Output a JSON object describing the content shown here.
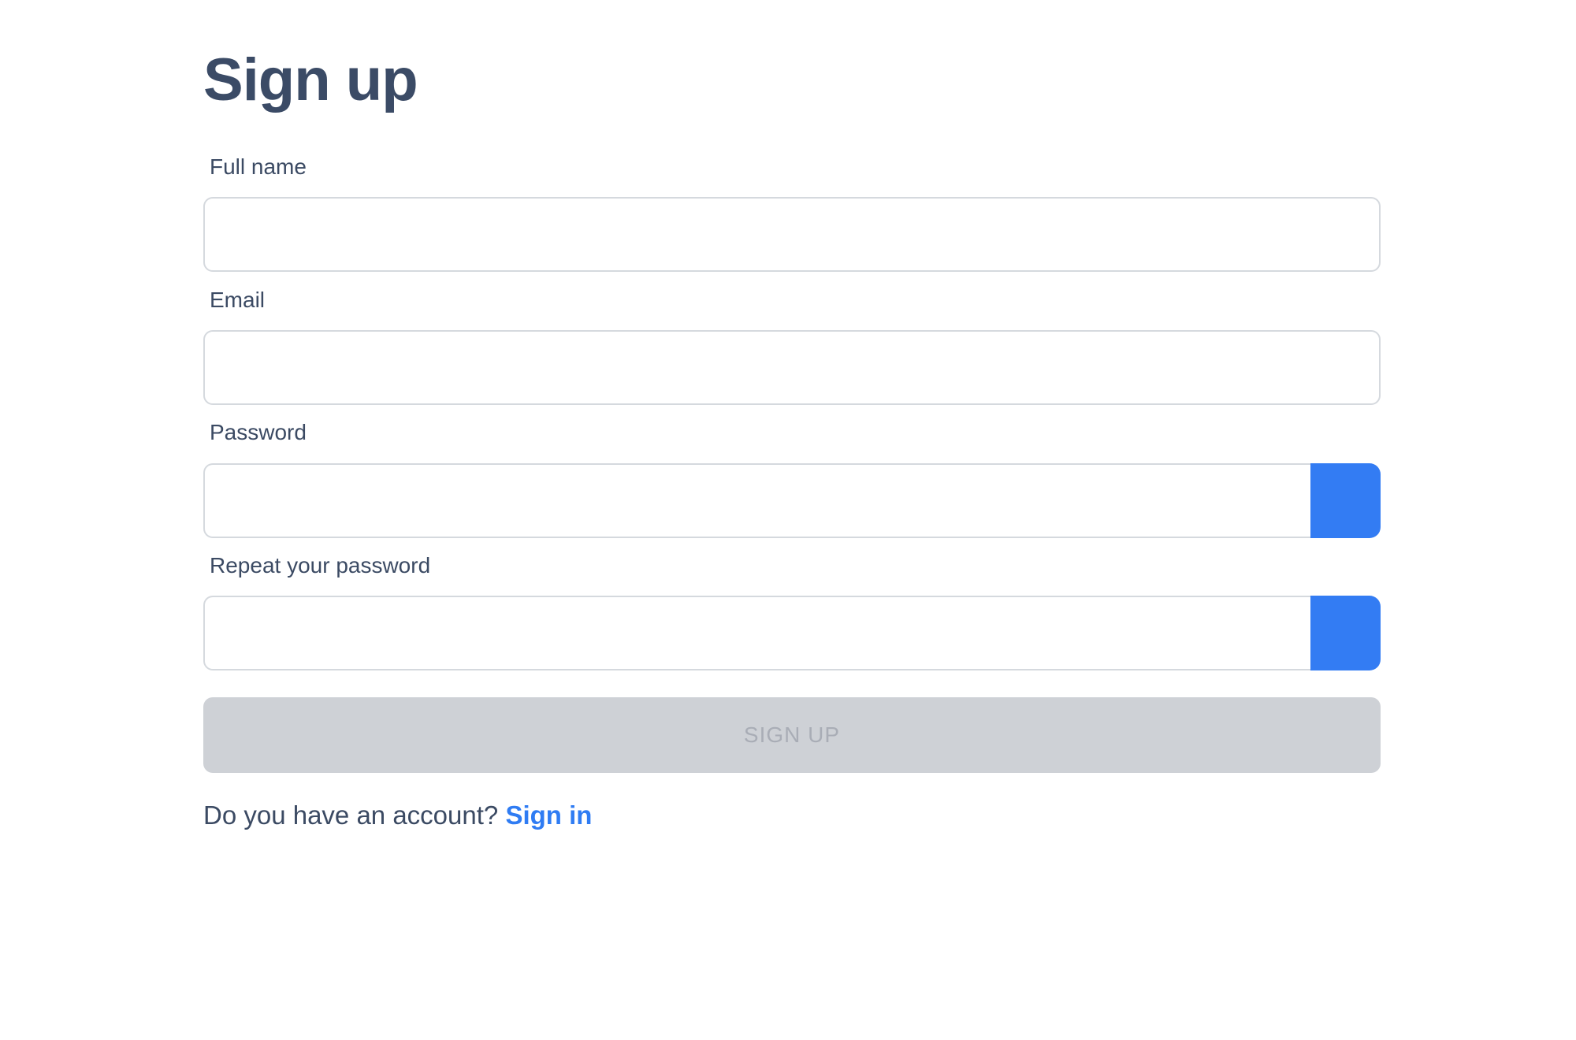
{
  "page": {
    "title": "Sign up",
    "fields": {
      "full_name": {
        "label": "Full name",
        "value": ""
      },
      "email": {
        "label": "Email",
        "value": ""
      },
      "password": {
        "label": "Password",
        "value": ""
      },
      "repeat_password": {
        "label": "Repeat your password",
        "value": ""
      }
    },
    "submit_label": "SIGN UP",
    "footer": {
      "prompt": "Do you have an account?",
      "link": "Sign in"
    }
  },
  "colors": {
    "accent": "#337cf3",
    "disabled_button": "#ced1d6",
    "text": "#3b4a63"
  }
}
